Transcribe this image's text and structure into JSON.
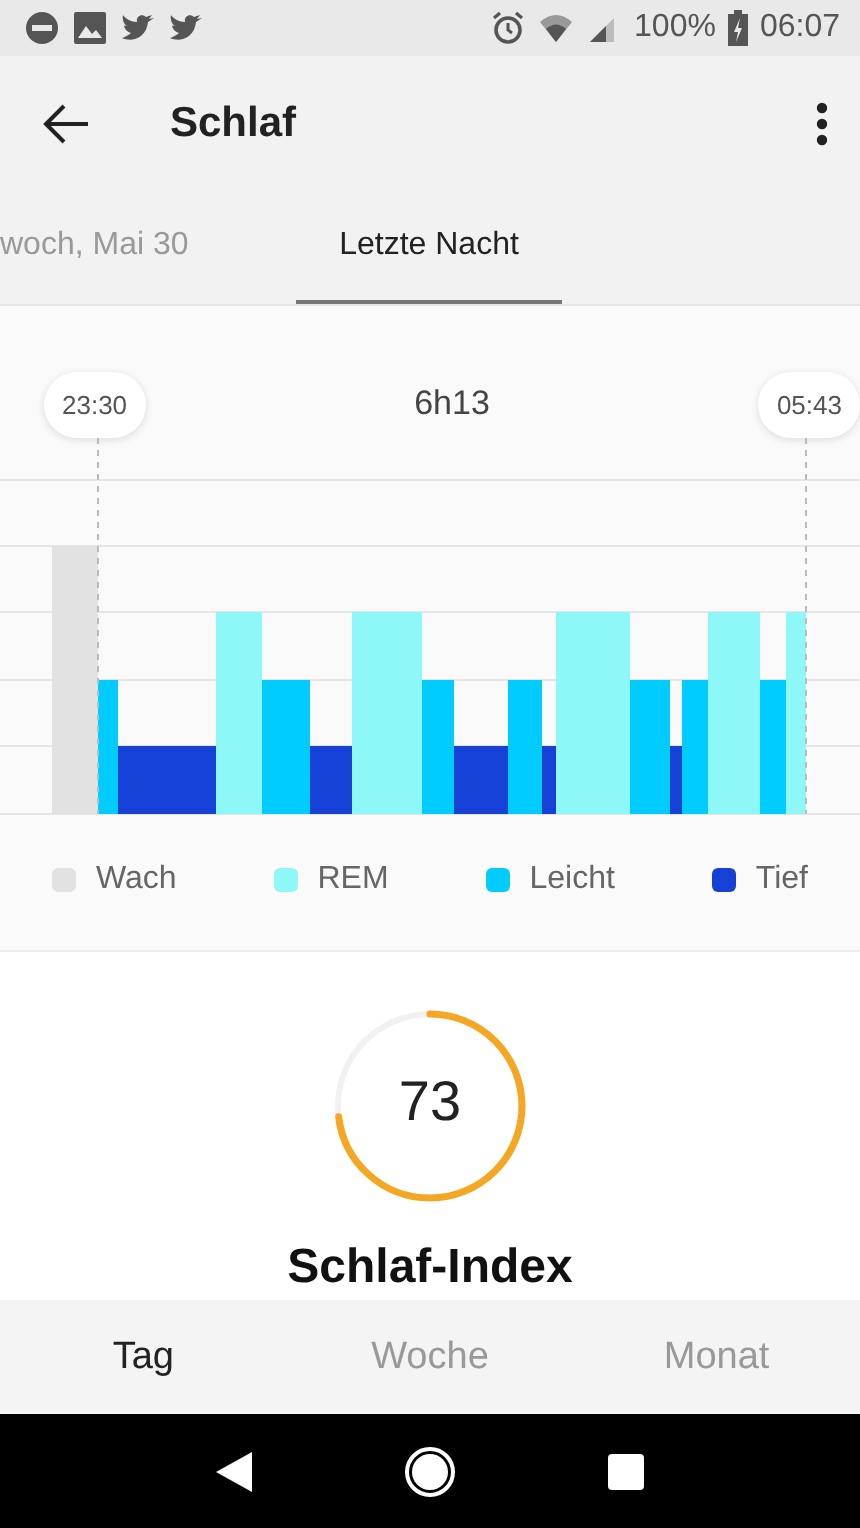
{
  "status_bar": {
    "battery": "100%",
    "time": "06:07"
  },
  "app_bar": {
    "title": "Schlaf"
  },
  "tabs": [
    {
      "label": "woch, Mai 30",
      "selected": false
    },
    {
      "label": "Letzte Nacht",
      "selected": true
    }
  ],
  "sleep_chart": {
    "start": "23:30",
    "duration": "6h13",
    "end": "05:43",
    "legend": [
      {
        "label": "Wach",
        "color": "#e2e2e2"
      },
      {
        "label": "REM",
        "color": "#8ef8f8"
      },
      {
        "label": "Leicht",
        "color": "#00ccff"
      },
      {
        "label": "Tief",
        "color": "#1641d6"
      }
    ]
  },
  "score": {
    "value": "73",
    "level": 0.73,
    "title": "Schlaf-Index"
  },
  "bottom_tabs": [
    {
      "label": "Tag",
      "selected": true
    },
    {
      "label": "Woche",
      "selected": false
    },
    {
      "label": "Monat",
      "selected": false
    }
  ]
}
